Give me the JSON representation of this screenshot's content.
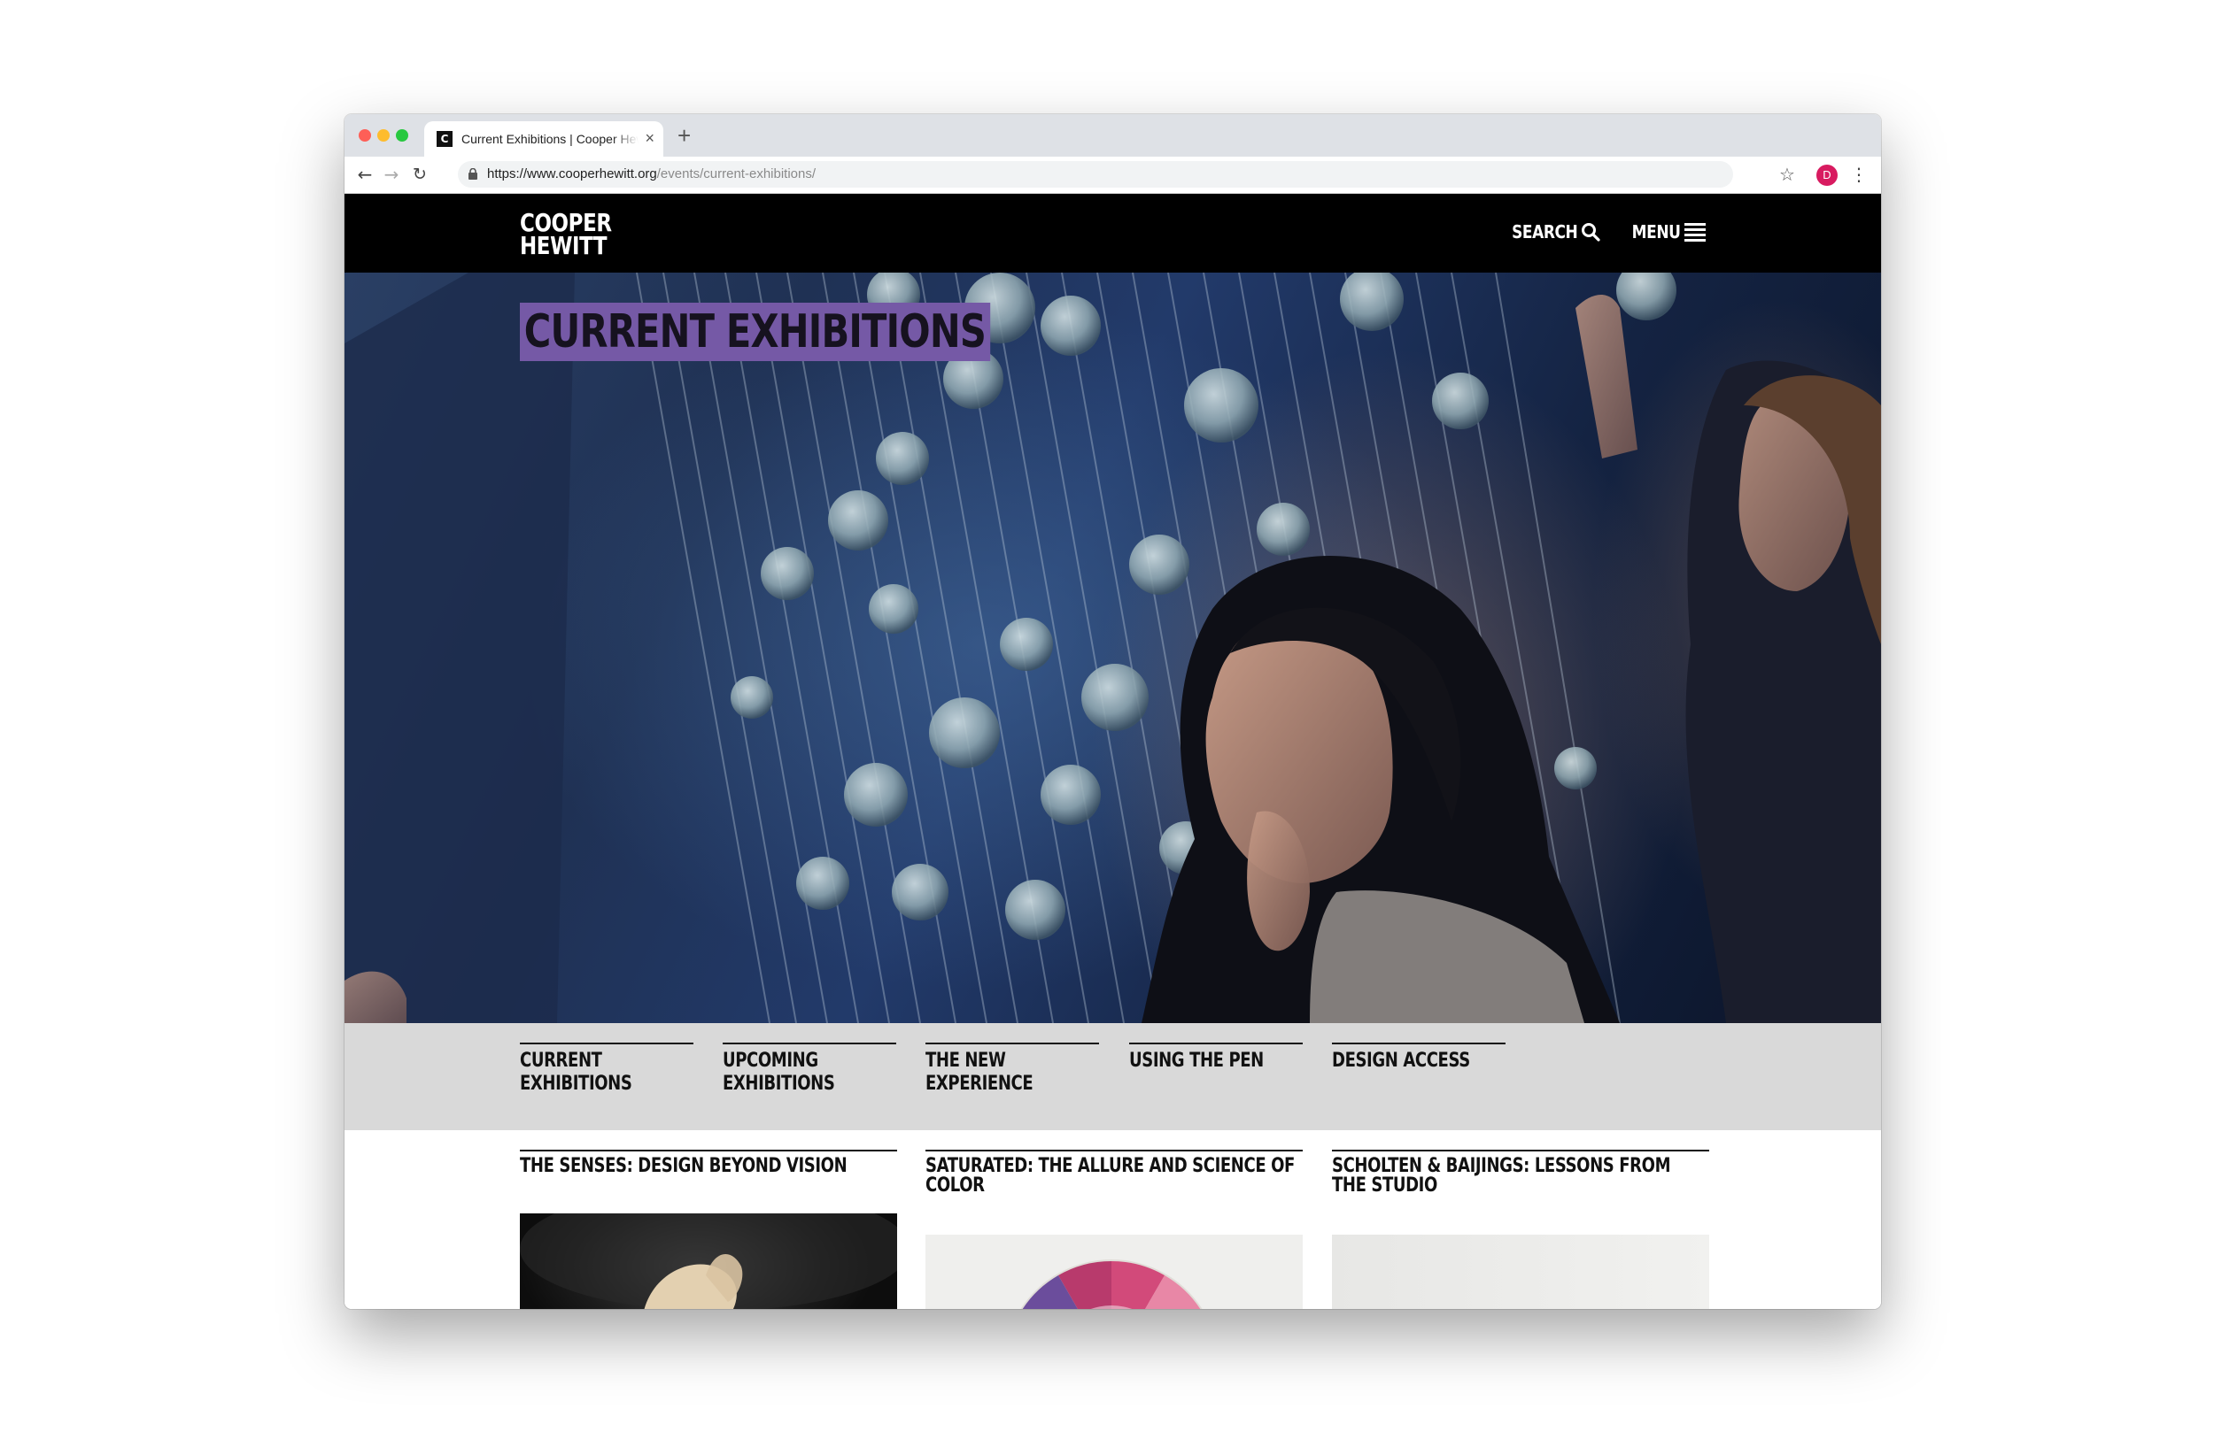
{
  "browser": {
    "tab_title": "Current Exhibitions | Cooper Hewitt",
    "favicon_letter": "C",
    "tab_close": "×",
    "new_tab": "+",
    "url_base": "https://www.cooperhewitt.org",
    "url_path": "/events/current-exhibitions/",
    "profile_initial": "D"
  },
  "site": {
    "logo_line1": "COOPER",
    "logo_line2": "HEWITT",
    "search_label": "SEARCH",
    "menu_label": "MENU"
  },
  "hero": {
    "title": "CURRENT EXHIBITIONS"
  },
  "subnav": {
    "items": [
      {
        "line1": "CURRENT",
        "line2": "EXHIBITIONS"
      },
      {
        "line1": "UPCOMING",
        "line2": "EXHIBITIONS"
      },
      {
        "line1": "THE NEW",
        "line2": "EXPERIENCE"
      },
      {
        "line1": "USING THE PEN",
        "line2": ""
      },
      {
        "line1": "DESIGN ACCESS",
        "line2": ""
      }
    ]
  },
  "exhibitions": [
    {
      "title": "THE SENSES: DESIGN BEYOND VISION"
    },
    {
      "title": "SATURATED: THE ALLURE AND SCIENCE OF COLOR"
    },
    {
      "title": "SCHOLTEN & BAIJINGS: LESSONS FROM THE STUDIO"
    }
  ],
  "colors": {
    "title_highlight": "#7559a6",
    "subnav_bg": "#d9d9d9",
    "header_bg": "#000000"
  }
}
